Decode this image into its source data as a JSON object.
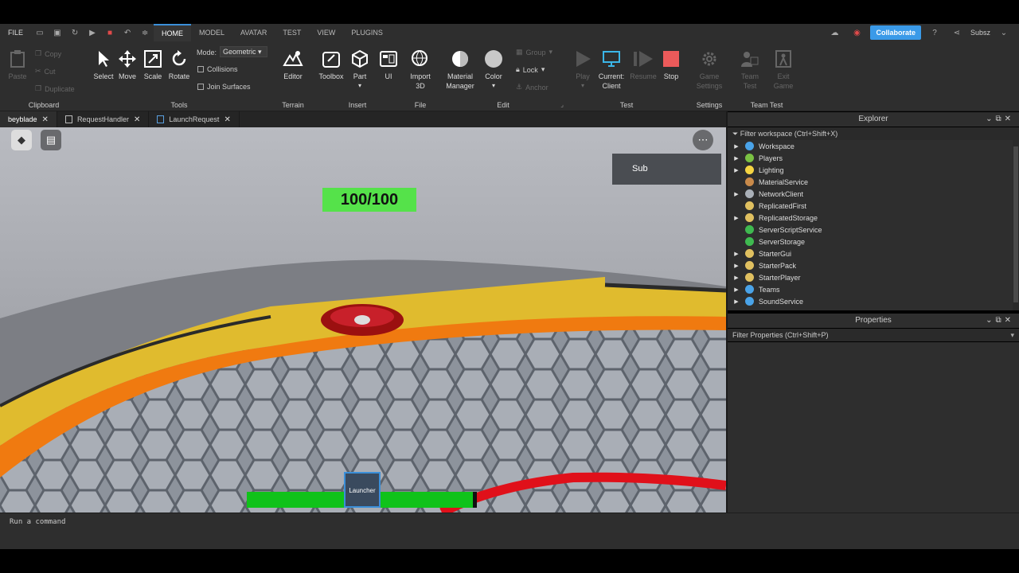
{
  "menubar": {
    "file": "FILE",
    "tabs": [
      "HOME",
      "MODEL",
      "AVATAR",
      "TEST",
      "VIEW",
      "PLUGINS"
    ],
    "active_tab": "HOME",
    "collaborate": "Collaborate",
    "user": "Subsz"
  },
  "ribbon": {
    "clipboard": {
      "label": "Clipboard",
      "paste": "Paste",
      "copy": "Copy",
      "cut": "Cut",
      "duplicate": "Duplicate"
    },
    "tools": {
      "label": "Tools",
      "select": "Select",
      "move": "Move",
      "scale": "Scale",
      "rotate": "Rotate",
      "mode_label": "Mode:",
      "mode_value": "Geometric",
      "collisions": "Collisions",
      "join_surfaces": "Join Surfaces"
    },
    "terrain": {
      "label": "Terrain",
      "editor": "Editor"
    },
    "insert": {
      "label": "Insert",
      "toolbox": "Toolbox",
      "part": "Part",
      "ui": "UI"
    },
    "file": {
      "label": "File",
      "import": "Import",
      "import2": "3D"
    },
    "edit": {
      "label": "Edit",
      "material": "Material",
      "material2": "Manager",
      "color": "Color",
      "group": "Group",
      "lock": "Lock",
      "anchor": "Anchor"
    },
    "test": {
      "label": "Test",
      "play": "Play",
      "current": "Current:",
      "current2": "Client",
      "resume": "Resume",
      "stop": "Stop"
    },
    "settings": {
      "label": "Settings",
      "game": "Game",
      "game2": "Settings"
    },
    "teamtest": {
      "label": "Team Test",
      "team": "Team",
      "team2": "Test",
      "exit": "Exit",
      "exit2": "Game"
    }
  },
  "doc_tabs": [
    {
      "label": "beyblade",
      "active": true
    },
    {
      "label": "RequestHandler",
      "active": false
    },
    {
      "label": "LaunchRequest",
      "active": false
    }
  ],
  "viewport": {
    "health": "100/100",
    "sub_button": "Sub",
    "launcher": "Launcher",
    "power_level": 0.95
  },
  "command_bar": {
    "placeholder": "Run a command"
  },
  "explorer": {
    "title": "Explorer",
    "filter": "Filter workspace (Ctrl+Shift+X)",
    "items": [
      {
        "label": "Workspace",
        "expandable": true,
        "color": "#4aa3e8"
      },
      {
        "label": "Players",
        "expandable": true,
        "color": "#7ac143"
      },
      {
        "label": "Lighting",
        "expandable": true,
        "color": "#f5d442"
      },
      {
        "label": "MaterialService",
        "expandable": false,
        "color": "#c98a4a"
      },
      {
        "label": "NetworkClient",
        "expandable": true,
        "color": "#aab0b8"
      },
      {
        "label": "ReplicatedFirst",
        "expandable": false,
        "color": "#e0c060"
      },
      {
        "label": "ReplicatedStorage",
        "expandable": true,
        "color": "#e0c060"
      },
      {
        "label": "ServerScriptService",
        "expandable": false,
        "color": "#3fb950"
      },
      {
        "label": "ServerStorage",
        "expandable": false,
        "color": "#3fb950"
      },
      {
        "label": "StarterGui",
        "expandable": true,
        "color": "#e0c060"
      },
      {
        "label": "StarterPack",
        "expandable": true,
        "color": "#e0c060"
      },
      {
        "label": "StarterPlayer",
        "expandable": true,
        "color": "#e0c060"
      },
      {
        "label": "Teams",
        "expandable": true,
        "color": "#4aa3e8"
      },
      {
        "label": "SoundService",
        "expandable": true,
        "color": "#4aa3e8"
      }
    ]
  },
  "properties": {
    "title": "Properties",
    "filter": "Filter Properties (Ctrl+Shift+P)"
  }
}
